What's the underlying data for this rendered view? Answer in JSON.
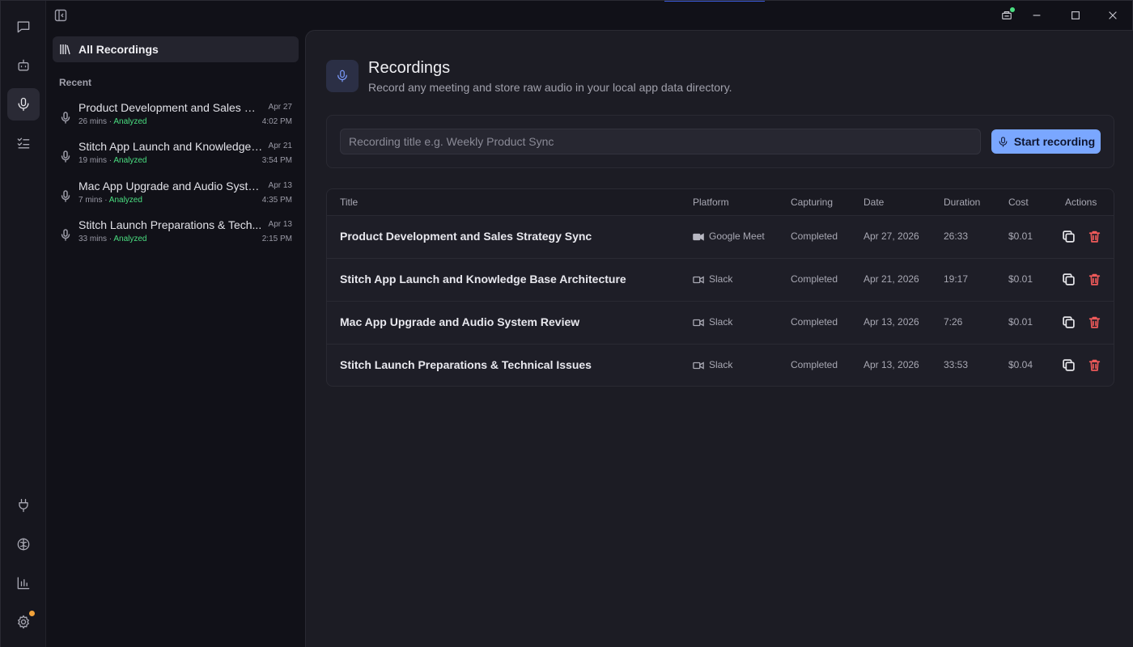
{
  "rail": {
    "top_items": [
      "chat-icon",
      "bot-icon",
      "microphone-icon",
      "tasks-icon"
    ],
    "bottom_items": [
      "plug-icon",
      "brain-icon",
      "chart-icon",
      "gear-icon"
    ],
    "active": "microphone-icon"
  },
  "sidebar": {
    "all_recordings_label": "All Recordings",
    "recent_label": "Recent",
    "items": [
      {
        "title": "Product Development and Sales St...",
        "duration": "26 mins",
        "sep": " · ",
        "status": "Analyzed",
        "date": "Apr 27",
        "time": "4:02 PM"
      },
      {
        "title": "Stitch App Launch and Knowledge ...",
        "duration": "19 mins",
        "sep": " · ",
        "status": "Analyzed",
        "date": "Apr 21",
        "time": "3:54 PM"
      },
      {
        "title": "Mac App Upgrade and Audio Syste...",
        "duration": "7 mins",
        "sep": " · ",
        "status": "Analyzed",
        "date": "Apr 13",
        "time": "4:35 PM"
      },
      {
        "title": "Stitch Launch Preparations & Tech...",
        "duration": "33 mins",
        "sep": " · ",
        "status": "Analyzed",
        "date": "Apr 13",
        "time": "2:15 PM"
      }
    ]
  },
  "header": {
    "title": "Recordings",
    "subtitle": "Record any meeting and store raw audio in your local app data directory."
  },
  "recorder": {
    "placeholder": "Recording title e.g. Weekly Product Sync",
    "value": "",
    "start_label": "Start recording"
  },
  "table": {
    "columns": {
      "title": "Title",
      "platform": "Platform",
      "capturing": "Capturing",
      "date": "Date",
      "duration": "Duration",
      "cost": "Cost",
      "actions": "Actions"
    },
    "rows": [
      {
        "title": "Product Development and Sales Strategy Sync",
        "platform": "Google Meet",
        "capturing": "Completed",
        "date": "Apr 27, 2026",
        "duration": "26:33",
        "cost": "$0.01"
      },
      {
        "title": "Stitch App Launch and Knowledge Base Architecture",
        "platform": "Slack",
        "capturing": "Completed",
        "date": "Apr 21, 2026",
        "duration": "19:17",
        "cost": "$0.01"
      },
      {
        "title": "Mac App Upgrade and Audio System Review",
        "platform": "Slack",
        "capturing": "Completed",
        "date": "Apr 13, 2026",
        "duration": "7:26",
        "cost": "$0.01"
      },
      {
        "title": "Stitch Launch Preparations & Technical Issues",
        "platform": "Slack",
        "capturing": "Completed",
        "date": "Apr 13, 2026",
        "duration": "33:53",
        "cost": "$0.04"
      }
    ]
  },
  "colors": {
    "accent": "#7aa7ff",
    "analyzed": "#4ade80",
    "delete": "#f05a5a",
    "notification": "#f2a23a"
  }
}
